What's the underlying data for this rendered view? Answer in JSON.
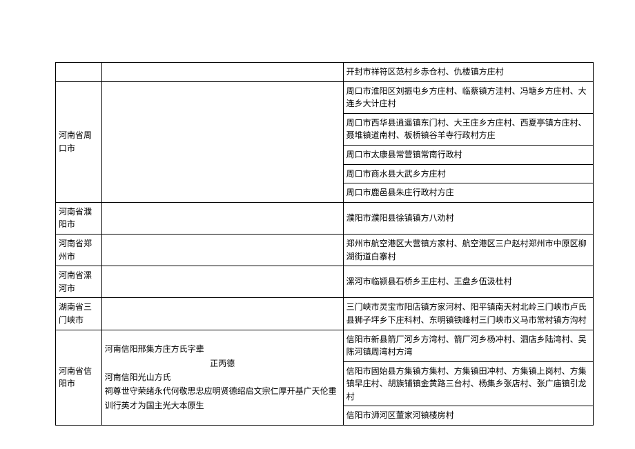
{
  "rows": {
    "kaifeng_top": {
      "right": "开封市祥符区范村乡赤仓村、仇楼镇方庄村"
    },
    "zhoukou": {
      "region": "河南省周口市",
      "r1": "周口市淮阳区刘振屯乡方庄村、临蔡镇方洼村、冯塘乡方庄村、大连乡大计庄村",
      "r2": "周口市西华县逍遥镇东门村、大王庄乡方庄村、西夏亭镇方庄村、聂堆镇道南村、板桥镇谷羊寺行政村方庄",
      "r3": "周口市太康县常营镇常南行政村",
      "r4": "周口市商水县大武乡方庄村",
      "r5": "周口市鹿邑县朱庄行政村方庄"
    },
    "puyang": {
      "region": "河南省濮阳市",
      "right": "濮阳市濮阳县徐镇镇方八劝村"
    },
    "zhengzhou": {
      "region": "河南省郑州市",
      "right": "郑州市航空港区大营镇方家村、航空港区三户赵村郑州市中原区柳湖街道白寨村"
    },
    "luohe": {
      "region": "河南省漯河市",
      "right": "漯河市临颍县石桥乡王庄村、王盘乡伍汲杜村"
    },
    "sanmenxia": {
      "region": "湖南省三门峡市",
      "right": "三门峡市灵宝市阳店镇方家河村、阳平镇南天村北岭三门峡市卢氏县狮子坪乡下庄科村、东明镇铁峰村三门峡市义马市常村镇方沟村"
    },
    "xinyang": {
      "region": "河南省信阳市",
      "mid_line1": "河南信阳邢集方庄方氏字辈",
      "mid_line2": "正丙德",
      "mid_line3": "河南信阳光山方氏",
      "mid_line4": "祠尊世守荣绪永代何敬思忠应明贤德绍启文宗仁厚开基广天伦重训行英才为国主光大本原生",
      "r1": "信阳市新县箭厂河乡方湾村、箭厂河乡杨冲村、泗店乡陆湾村、吴陈河镇周湾村方湾",
      "r2": "信阳市固始县方集镇方集村、方集镇田冲村、方集镇上岗村、方集镇早庄村、胡族铺镇金黄路三台村、杨集乡张店村、张广庙镇引龙村",
      "r3": "信阳市浉河区董家河镇楼房村"
    }
  }
}
